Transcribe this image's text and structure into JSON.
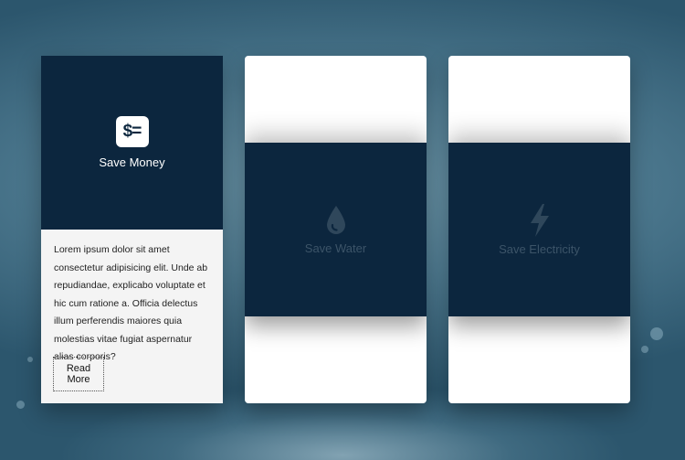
{
  "cards": [
    {
      "title": "Save Money",
      "icon": "dollar-list-icon",
      "icon_text": "$=",
      "text": "Lorem ipsum dolor sit amet consectetur adipisicing elit. Unde ab repudiandae, explicabo voluptate et hic cum ratione a. Officia delectus illum perferendis maiores quia molestias vitae fugiat aspernatur alias corporis?",
      "button_label": "Read More"
    },
    {
      "title": "Save Water",
      "icon": "water-drop-icon"
    },
    {
      "title": "Save Electricity",
      "icon": "lightning-bolt-icon"
    }
  ],
  "colors": {
    "panel": "#0c263e",
    "faded_icon": "#2f475b",
    "card_bg": "#ffffff"
  }
}
